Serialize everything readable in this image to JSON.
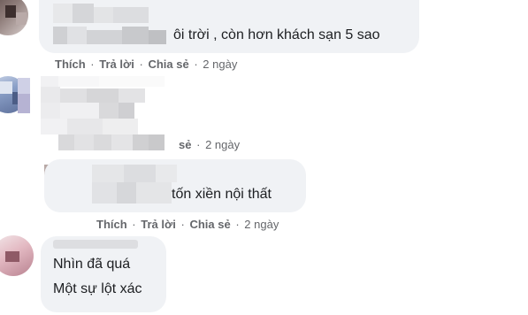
{
  "comments": [
    {
      "text": "ôi trời , còn hơn khách sạn 5 sao",
      "actions": {
        "like": "Thích",
        "reply": "Trả lời",
        "share": "Chia sẻ",
        "sep": "·",
        "time": "2 ngày"
      }
    },
    {
      "text": "",
      "actions": {
        "share": "sẻ",
        "sep": "·",
        "time": "2 ngày"
      }
    },
    {
      "text": "tốn xiền nội thất",
      "actions": {
        "like": "Thích",
        "reply": "Trả lời",
        "share": "Chia sẻ",
        "sep": "·",
        "time": "2 ngày"
      }
    },
    {
      "line1": "Nhìn đã quá",
      "line2": "Một sự lột xác"
    }
  ]
}
